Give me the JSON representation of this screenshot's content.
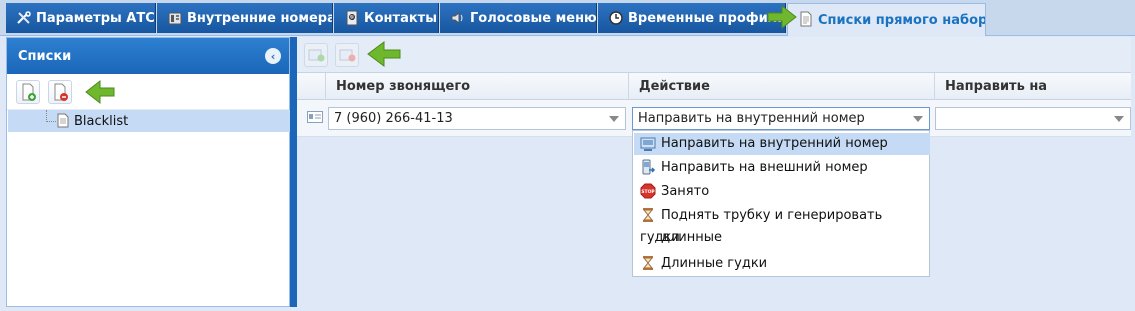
{
  "tabs": [
    {
      "label": "Параметры АТС",
      "icon": "tools-icon"
    },
    {
      "label": "Внутренние номера",
      "icon": "phone-icon"
    },
    {
      "label": "Контакты",
      "icon": "contacts-icon"
    },
    {
      "label": "Голосовые меню",
      "icon": "speaker-icon"
    },
    {
      "label": "Временные профили",
      "icon": "clock-icon"
    },
    {
      "label": "Списки прямого набора",
      "icon": "document-icon",
      "active": true
    }
  ],
  "left_panel": {
    "title": "Списки",
    "tree": [
      {
        "label": "Blacklist",
        "icon": "document-icon"
      }
    ]
  },
  "grid": {
    "columns": [
      "Номер звонящего",
      "Действие",
      "Направить на"
    ],
    "row": {
      "caller_number": "7 (960) 266-41-13",
      "action": "Направить на внутренний номер",
      "target": ""
    }
  },
  "action_dropdown": {
    "options": [
      {
        "label": "Направить на внутренний номер",
        "icon": "internal-number-icon",
        "selected": true
      },
      {
        "label": "Направить на внешний номер",
        "icon": "external-number-icon"
      },
      {
        "label": "Занято",
        "icon": "stop-icon",
        "icon_text": "STOP"
      },
      {
        "label": "Поднять трубку и генерировать длинные",
        "label_cont": "гудки",
        "icon": "hourglass-icon"
      },
      {
        "label": "Длинные гудки",
        "icon": "hourglass-icon"
      }
    ]
  },
  "colors": {
    "tab_blue": "#1b66b8",
    "active_tab_text": "#1a73c0",
    "selection": "#c5daf4",
    "arrow_green": "#6fb82e"
  }
}
